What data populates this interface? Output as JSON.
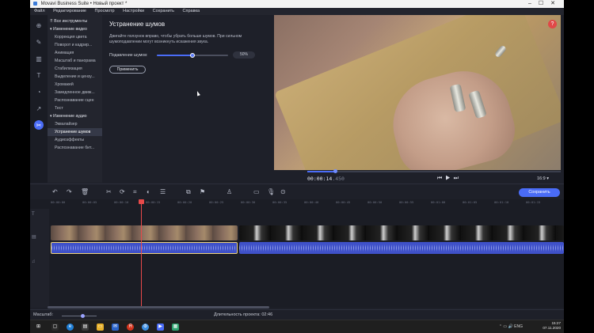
{
  "window": {
    "title": "Movavi Business Suite • Новый проект *"
  },
  "menu": [
    "Файл",
    "Редактирование",
    "Просмотр",
    "Настройки",
    "Сохранить",
    "Справка"
  ],
  "tools_panel": {
    "items": [
      {
        "label": "Все инструменты",
        "type": "head"
      },
      {
        "label": "Изменение видео",
        "type": "head"
      },
      {
        "label": "Коррекция цвета",
        "type": "item"
      },
      {
        "label": "Поворот и кадрир...",
        "type": "item"
      },
      {
        "label": "Анимация",
        "type": "item"
      },
      {
        "label": "Масштаб и панорама",
        "type": "item"
      },
      {
        "label": "Стабилизация",
        "type": "item"
      },
      {
        "label": "Выделение и цензу...",
        "type": "item"
      },
      {
        "label": "Хромакей",
        "type": "item"
      },
      {
        "label": "Замедленное движ...",
        "type": "item"
      },
      {
        "label": "Распознавание сцен",
        "type": "item"
      },
      {
        "label": "Тест",
        "type": "item"
      },
      {
        "label": "Изменение аудио",
        "type": "head"
      },
      {
        "label": "Эквалайзер",
        "type": "item"
      },
      {
        "label": "Устранение шумов",
        "type": "selected"
      },
      {
        "label": "Аудиоэффекты",
        "type": "item"
      },
      {
        "label": "Распознавание бит...",
        "type": "item"
      }
    ]
  },
  "settings": {
    "title": "Устранение шумов",
    "description": "Двигайте ползунок вправо, чтобы убрать больше шумов. При сильном шумоподавлении могут возникнуть искажения звука.",
    "slider_label": "Подавление шумов:",
    "slider_value": "50%",
    "slider_fraction": 0.5,
    "apply_label": "Применить"
  },
  "preview": {
    "help_icon": "question-icon",
    "timecode": "00:00:14",
    "timecode_ms": ".450",
    "seek_fraction": 0.11,
    "aspect": "16:9 ▾"
  },
  "toolbar": {
    "save_label": "Сохранить"
  },
  "ruler_ticks": [
    "00:00:00",
    "00:00:05",
    "00:00:10",
    "00:00:15",
    "00:00:20",
    "00:00:25",
    "00:00:30",
    "00:00:35",
    "00:00:40",
    "00:00:45",
    "00:00:50",
    "00:00:55",
    "00:01:00",
    "00:01:05",
    "00:01:10",
    "00:01:15"
  ],
  "statusbar": {
    "zoom_label": "Масштаб:",
    "zoom_fraction": 0.6,
    "duration": "Длительность проекта: 02:46"
  },
  "taskbar": {
    "time": "15:27",
    "date": "07.11.2020",
    "lang": "ENG"
  },
  "colors": {
    "accent": "#4a6cf7",
    "playhead": "#e84a4a",
    "background": "#1e2029"
  }
}
